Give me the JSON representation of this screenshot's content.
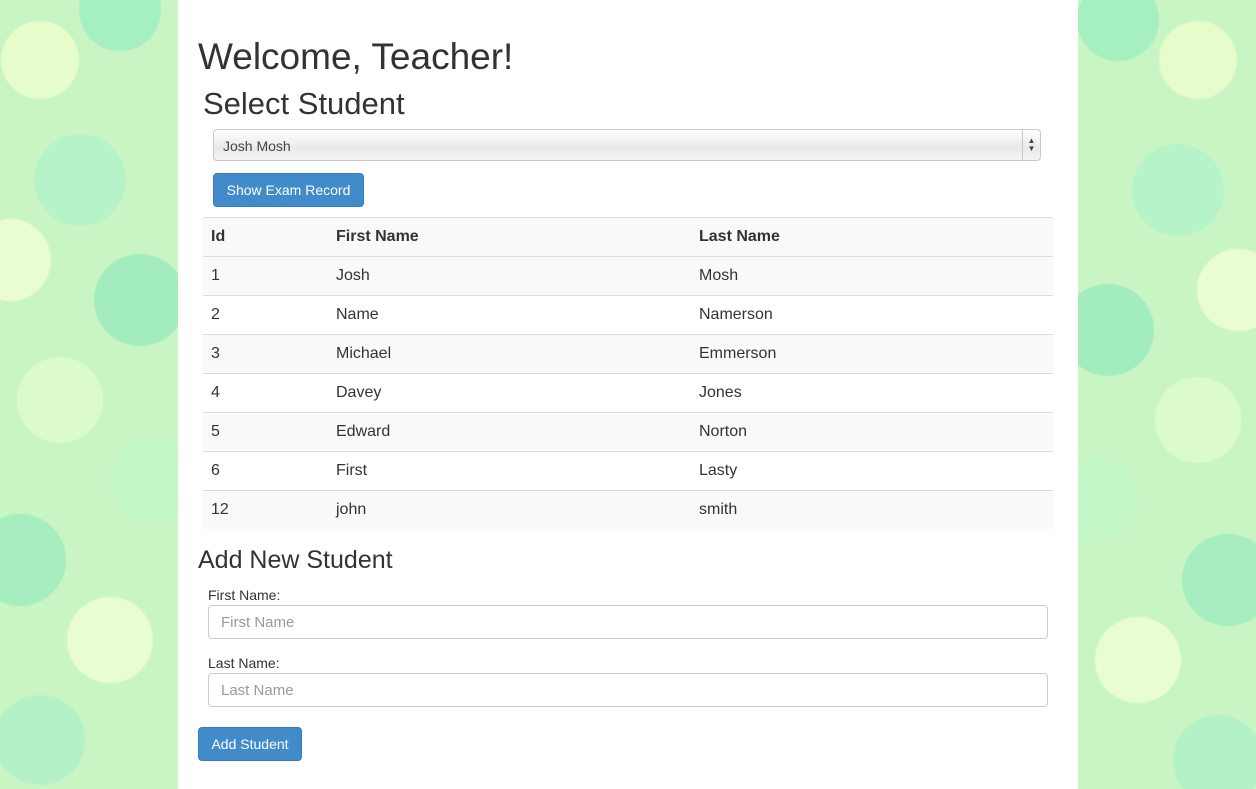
{
  "header": {
    "title": "Welcome, Teacher!"
  },
  "select_student": {
    "heading": "Select Student",
    "selected": "Josh Mosh",
    "show_button": "Show Exam Record"
  },
  "table": {
    "columns": [
      "Id",
      "First Name",
      "Last Name"
    ],
    "rows": [
      [
        "1",
        "Josh",
        "Mosh"
      ],
      [
        "2",
        "Name",
        "Namerson"
      ],
      [
        "3",
        "Michael",
        "Emmerson"
      ],
      [
        "4",
        "Davey",
        "Jones"
      ],
      [
        "5",
        "Edward",
        "Norton"
      ],
      [
        "6",
        "First",
        "Lasty"
      ],
      [
        "12",
        "john",
        "smith"
      ]
    ]
  },
  "add_student": {
    "heading": "Add New Student",
    "first_label": "First Name:",
    "first_placeholder": "First Name",
    "last_label": "Last Name:",
    "last_placeholder": "Last Name",
    "add_button": "Add Student"
  },
  "colors": {
    "primary_button": "#428bca",
    "background_green": "#c9f5c4"
  }
}
